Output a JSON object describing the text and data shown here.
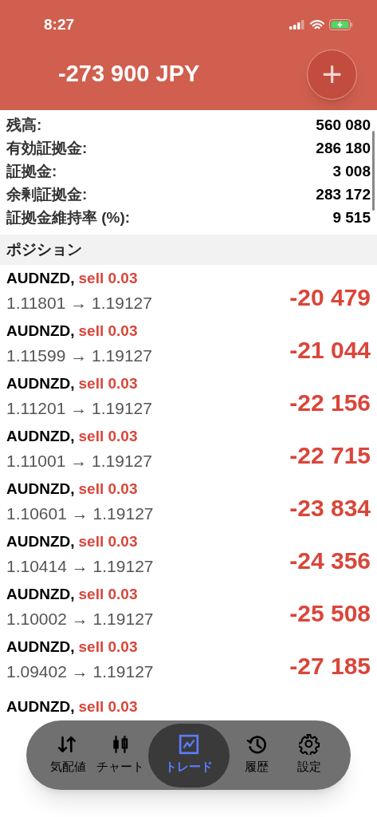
{
  "status_bar": {
    "time": "8:27"
  },
  "header": {
    "balance": "-273 900 JPY",
    "add_button": "+"
  },
  "summary": [
    {
      "label": "残高:",
      "value": "560 080"
    },
    {
      "label": "有効証拠金:",
      "value": "286 180"
    },
    {
      "label": "証拠金:",
      "value": "3 008"
    },
    {
      "label": "余剰証拠金:",
      "value": "283 172"
    },
    {
      "label": "証拠金維持率 (%):",
      "value": "9 515"
    }
  ],
  "section_title": "ポジション",
  "positions": [
    {
      "symbol": "AUDNZD,",
      "order": "sell 0.03",
      "kind": "sell",
      "prices": "1.11801 → 1.19127",
      "profit": "-20 479"
    },
    {
      "symbol": "AUDNZD,",
      "order": "sell 0.03",
      "kind": "sell",
      "prices": "1.11599 → 1.19127",
      "profit": "-21 044"
    },
    {
      "symbol": "AUDNZD,",
      "order": "sell 0.03",
      "kind": "sell",
      "prices": "1.11201 → 1.19127",
      "profit": "-22 156"
    },
    {
      "symbol": "AUDNZD,",
      "order": "sell 0.03",
      "kind": "sell",
      "prices": "1.11001 → 1.19127",
      "profit": "-22 715"
    },
    {
      "symbol": "AUDNZD,",
      "order": "sell 0.03",
      "kind": "sell",
      "prices": "1.10601 → 1.19127",
      "profit": "-23 834"
    },
    {
      "symbol": "AUDNZD,",
      "order": "sell 0.03",
      "kind": "sell",
      "prices": "1.10414 → 1.19127",
      "profit": "-24 356"
    },
    {
      "symbol": "AUDNZD,",
      "order": "sell 0.03",
      "kind": "sell",
      "prices": "1.10002 → 1.19127",
      "profit": "-25 508"
    },
    {
      "symbol": "AUDNZD,",
      "order": "sell 0.03",
      "kind": "sell",
      "prices": "1.09402 → 1.19127",
      "profit": "-27 185"
    },
    {
      "symbol": "AUDNZD,",
      "order": "sell 0.03",
      "kind": "sell"
    }
  ],
  "tabs": [
    {
      "label": "気配値",
      "kind": "quotes",
      "selected": false
    },
    {
      "label": "チャート",
      "kind": "chart",
      "selected": false
    },
    {
      "label": "トレード",
      "kind": "trade",
      "selected": true
    },
    {
      "label": "履歴",
      "kind": "history",
      "selected": false
    },
    {
      "label": "設定",
      "kind": "settings",
      "selected": false
    }
  ]
}
